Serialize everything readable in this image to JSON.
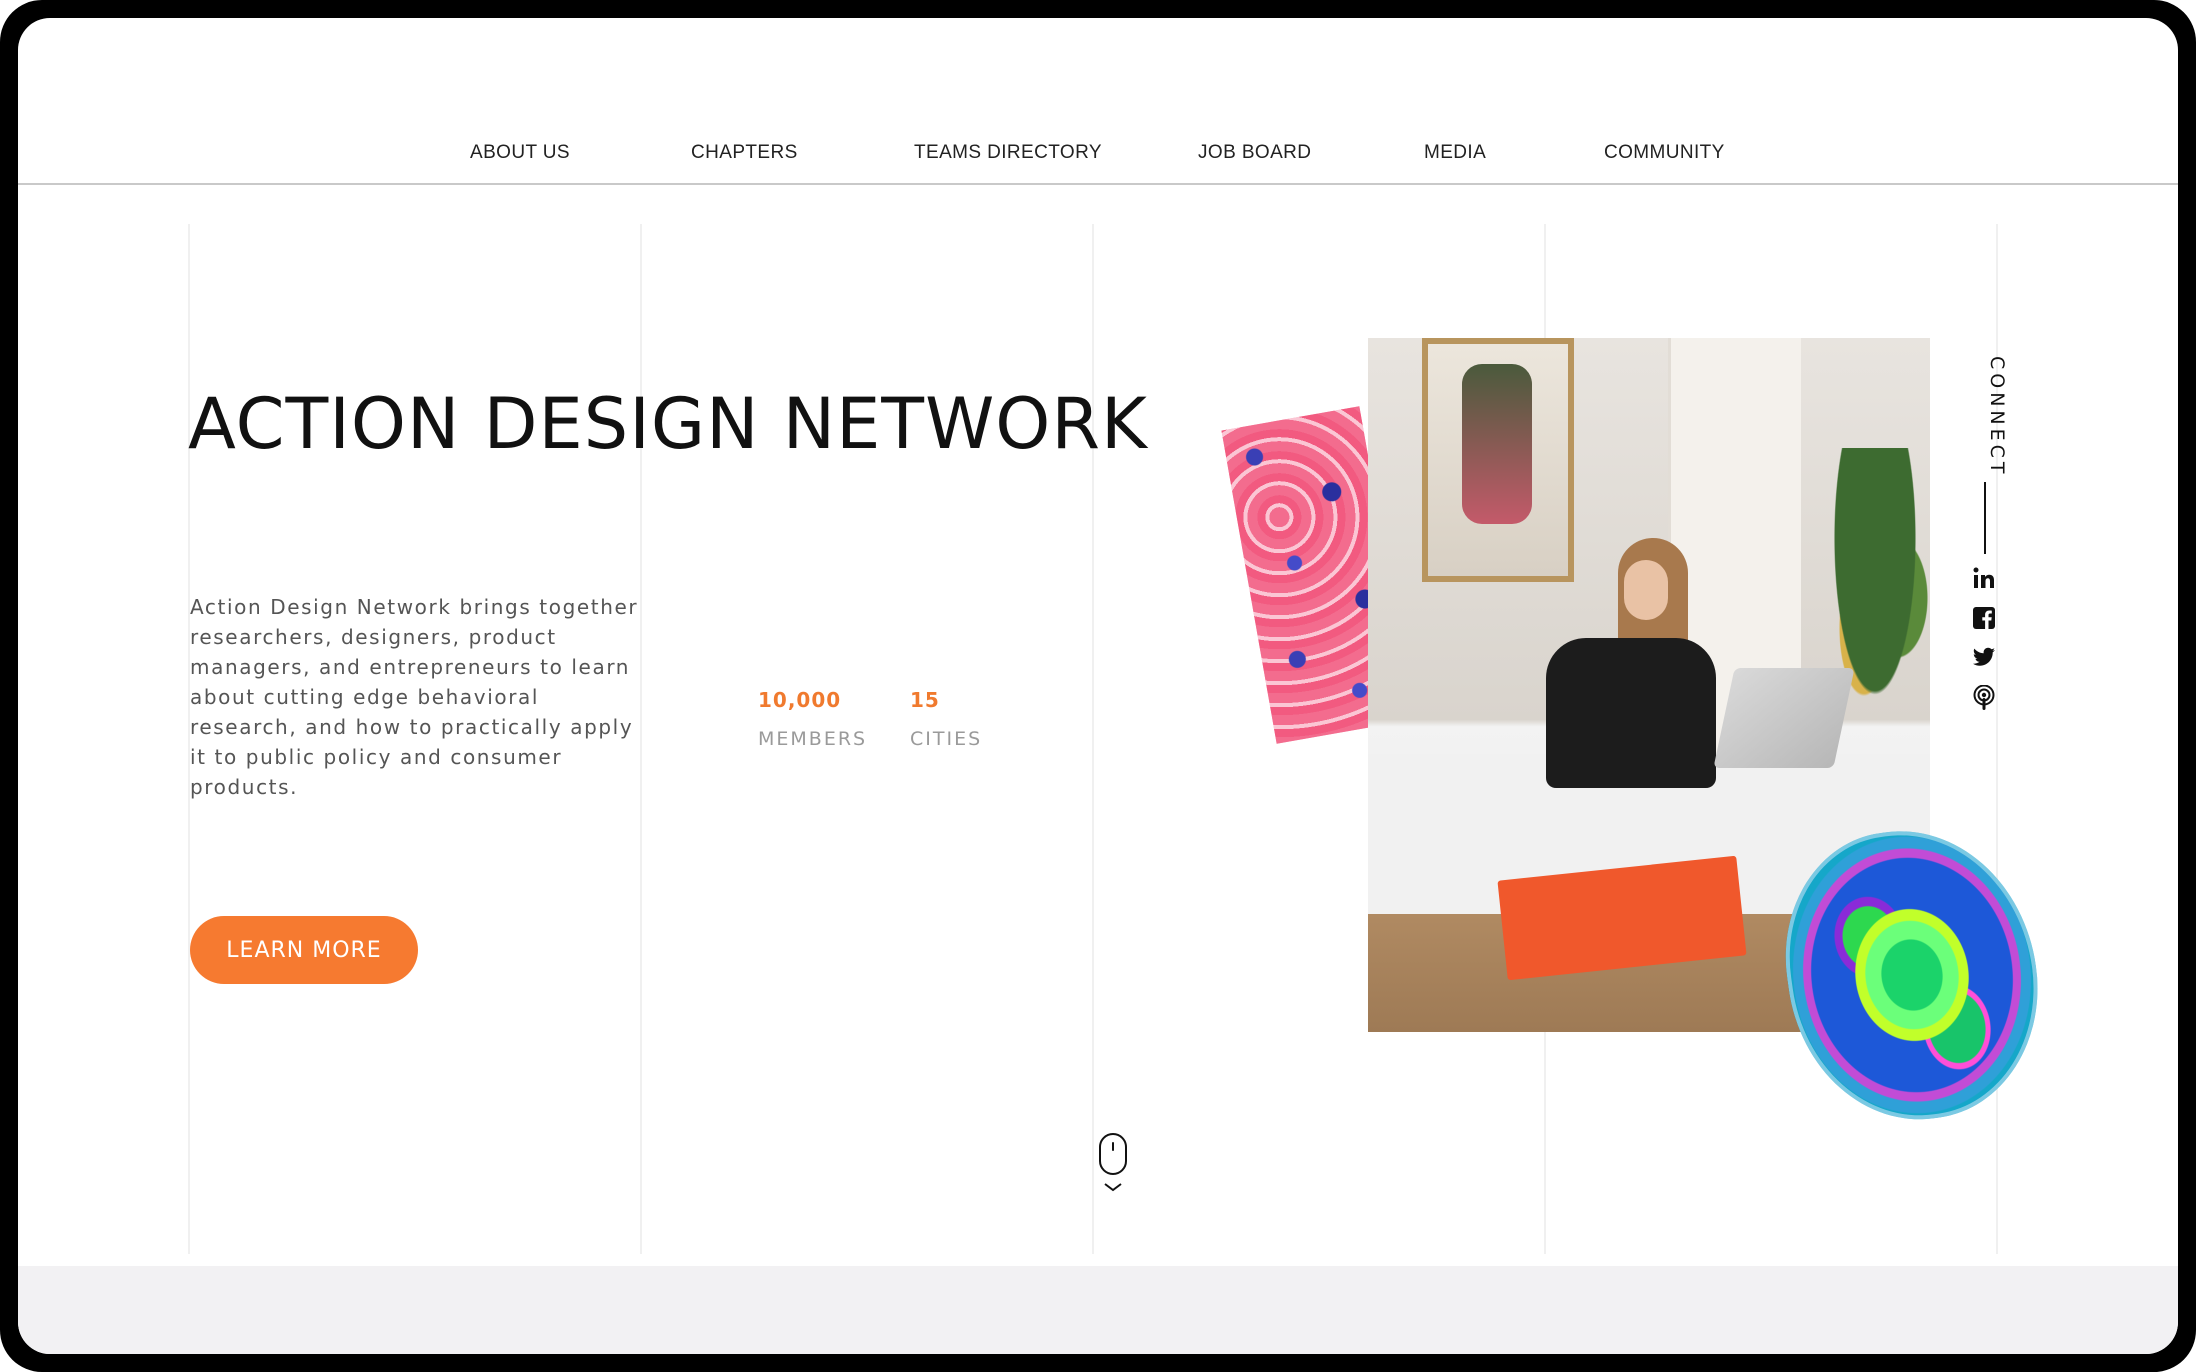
{
  "nav": {
    "items": [
      {
        "label": "ABOUT US"
      },
      {
        "label": "CHAPTERS"
      },
      {
        "label": "TEAMS DIRECTORY"
      },
      {
        "label": "JOB BOARD"
      },
      {
        "label": "MEDIA"
      },
      {
        "label": "COMMUNITY"
      }
    ]
  },
  "hero": {
    "title": "ACTION DESIGN NETWORK",
    "description": "Action Design Network brings together researchers, designers, product managers, and entrepreneurs to learn about cutting edge behavioral research, and how to practically apply it to public policy and consumer products.",
    "stats": [
      {
        "value": "10,000",
        "label": "MEMBERS"
      },
      {
        "value": "15",
        "label": "CITIES"
      }
    ],
    "cta_label": "LEARN MORE"
  },
  "sidebar": {
    "connect_label": "CONNECT",
    "social_icons": [
      "linkedin-icon",
      "facebook-icon",
      "twitter-icon",
      "podcast-icon"
    ]
  },
  "colors": {
    "accent": "#f67a30",
    "stat_value": "#f07a2e",
    "frame": "#000000",
    "footer_band": "#f2f1f3"
  }
}
